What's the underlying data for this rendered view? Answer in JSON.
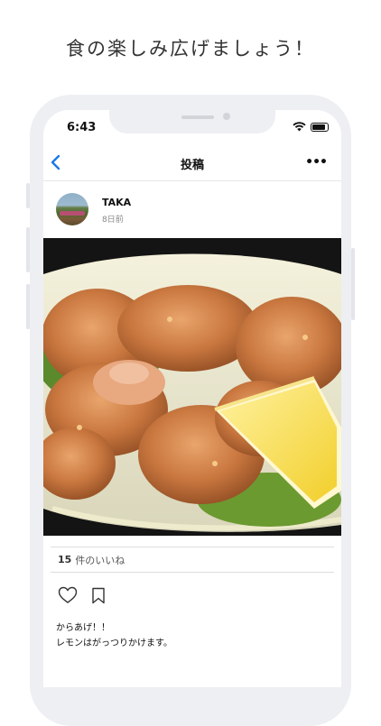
{
  "headline": "食の楽しみ広げましょう！",
  "status_bar": {
    "time": "6:43"
  },
  "navbar": {
    "title": "投稿",
    "more_label": "•••"
  },
  "post": {
    "username": "TAKA",
    "posted_ago": "8日前",
    "likes_count": "15",
    "likes_suffix": "件のいいね",
    "caption_line1": "からあげ！！",
    "caption_line2": "レモンはがっつりかけます。"
  },
  "colors": {
    "accent": "#1a7ae6",
    "screen_bg": "#ffffff",
    "frame": "#eeeff3"
  },
  "icons": [
    "back-chevron-icon",
    "wifi-icon",
    "battery-icon",
    "more-icon",
    "heart-icon",
    "bookmark-icon"
  ]
}
